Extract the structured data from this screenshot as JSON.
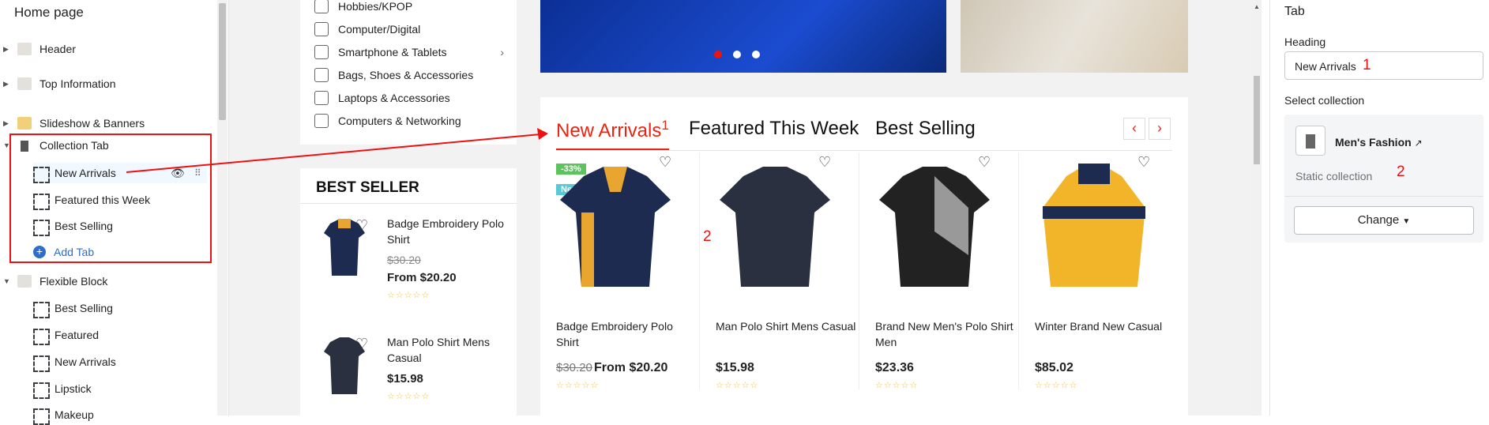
{
  "left_panel": {
    "page_title": "Home page",
    "sections": [
      {
        "label": "Header"
      },
      {
        "label": "Top Information"
      },
      {
        "label": "Slideshow & Banners"
      },
      {
        "label": "Collection Tab"
      },
      {
        "label": "Flexible Block"
      }
    ],
    "collection_tab_items": [
      "New Arrivals",
      "Featured this Week",
      "Best Selling"
    ],
    "add_tab_label": "Add Tab",
    "flexible_block_items": [
      "Best Selling",
      "Featured",
      "New Arrivals",
      "Lipstick",
      "Makeup"
    ]
  },
  "preview": {
    "categories": [
      "Hobbies/KPOP",
      "Computer/Digital",
      "Smartphone & Tablets",
      "Bags, Shoes & Accessories",
      "Laptops & Accessories",
      "Computers & Networking"
    ],
    "best_seller": {
      "heading": "BEST SELLER",
      "items": [
        {
          "name": "Badge Embroidery Polo Shirt",
          "old_price": "$30.20",
          "price": "From $20.20"
        },
        {
          "name": "Man Polo Shirt Mens Casual",
          "price": "$15.98"
        }
      ]
    },
    "tabs": [
      "New Arrivals",
      "Featured This Week",
      "Best Selling"
    ],
    "tab_marker": "1",
    "products": [
      {
        "name": "Badge Embroidery Polo Shirt",
        "old_price": "$30.20",
        "price": "From $20.20",
        "badges": [
          "-33%",
          "New"
        ]
      },
      {
        "name": "Man Polo Shirt Mens Casual",
        "price": "$15.98"
      },
      {
        "name": "Brand New Men's Polo Shirt Men",
        "price": "$23.36"
      },
      {
        "name": "Winter Brand New Casual",
        "price": "$85.02"
      }
    ],
    "marker_2": "2"
  },
  "right_panel": {
    "title": "Tab",
    "heading_label": "Heading",
    "heading_value": "New Arrivals",
    "heading_marker": "1",
    "select_collection_label": "Select collection",
    "collection_name": "Men's Fashion",
    "collection_type": "Static collection",
    "collection_marker": "2",
    "change_button": "Change"
  },
  "colors": {
    "accent_red": "#e11",
    "banner_blue": "#1b4cd0",
    "admin_link": "#2c6ecb"
  }
}
